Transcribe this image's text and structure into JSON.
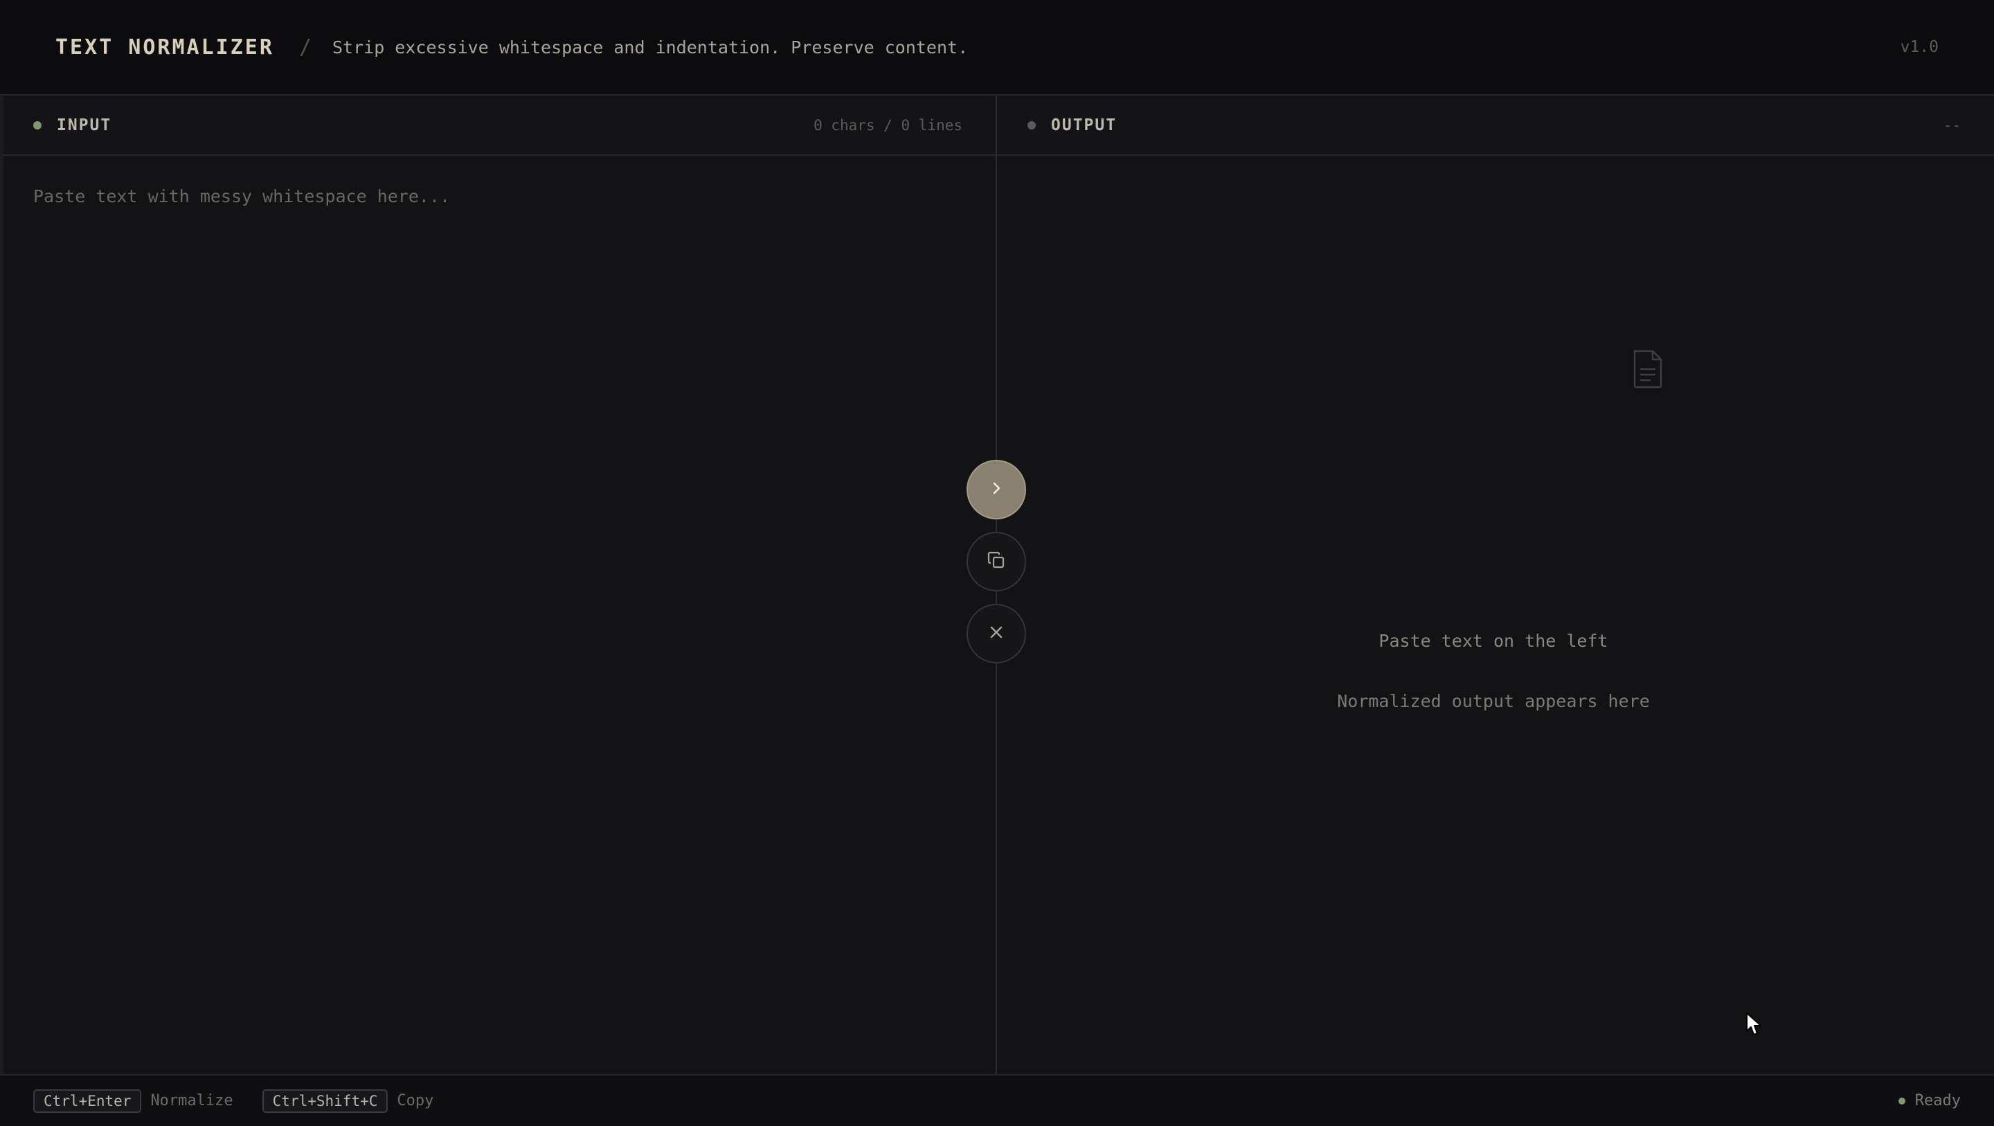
{
  "header": {
    "title": "TEXT NORMALIZER",
    "separator": "/",
    "subtitle": "Strip excessive whitespace and indentation. Preserve content.",
    "version": "v1.0"
  },
  "input_panel": {
    "label": "INPUT",
    "meta": "0 chars / 0 lines",
    "placeholder": "Paste text with messy whitespace here...",
    "value": ""
  },
  "output_panel": {
    "label": "OUTPUT",
    "meta": "--",
    "empty_icon": "document-icon",
    "empty_title": "Paste text on the left",
    "empty_subtitle": "Normalized output appears here"
  },
  "actions": {
    "normalize_icon": "chevron-right-icon",
    "copy_icon": "copy-icon",
    "clear_icon": "close-icon"
  },
  "footer": {
    "shortcuts": [
      {
        "keys": "Ctrl+Enter",
        "action": "Normalize"
      },
      {
        "keys": "Ctrl+Shift+C",
        "action": "Copy"
      }
    ],
    "status": "Ready"
  },
  "colors": {
    "accent": "#8a8070",
    "status_ready": "#7e9a6c",
    "background": "#121215"
  }
}
